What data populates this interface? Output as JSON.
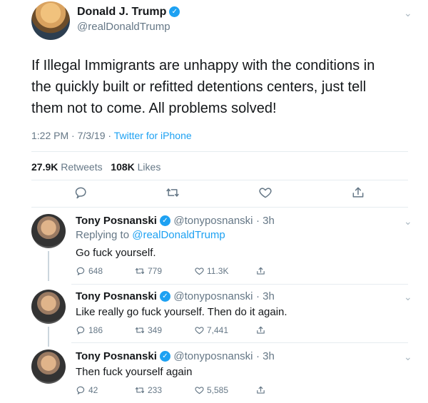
{
  "main_tweet": {
    "name": "Donald J. Trump",
    "handle": "@realDonaldTrump",
    "text": "If Illegal Immigrants are unhappy with the conditions in the quickly built or refitted detentions centers, just tell them not to come. All problems solved!",
    "time": "1:22 PM · 7/3/19 · ",
    "source": "Twitter for iPhone",
    "retweets_count": "27.9K",
    "retweets_label": "Retweets",
    "likes_count": "108K",
    "likes_label": "Likes"
  },
  "replies": [
    {
      "name": "Tony Posnanski",
      "handle": "@tonyposnanski",
      "time": "· 3h",
      "replying_prefix": "Replying to ",
      "replying_mention": "@realDonaldTrump",
      "text": "Go fuck yourself.",
      "reply_count": "648",
      "retweet_count": "779",
      "like_count": "11.3K"
    },
    {
      "name": "Tony Posnanski",
      "handle": "@tonyposnanski",
      "time": "· 3h",
      "text": "Like really go fuck yourself. Then do it again.",
      "reply_count": "186",
      "retweet_count": "349",
      "like_count": "7,441"
    },
    {
      "name": "Tony Posnanski",
      "handle": "@tonyposnanski",
      "time": "· 3h",
      "text": "Then fuck yourself again",
      "reply_count": "42",
      "retweet_count": "233",
      "like_count": "5,585"
    }
  ],
  "icons": {
    "verified": "verified-badge-icon",
    "chevron": "chevron-down-icon",
    "reply": "reply-icon",
    "retweet": "retweet-icon",
    "like": "heart-icon",
    "share": "share-icon"
  },
  "colors": {
    "accent": "#1da1f2",
    "text": "#14171a",
    "secondary": "#657786"
  }
}
